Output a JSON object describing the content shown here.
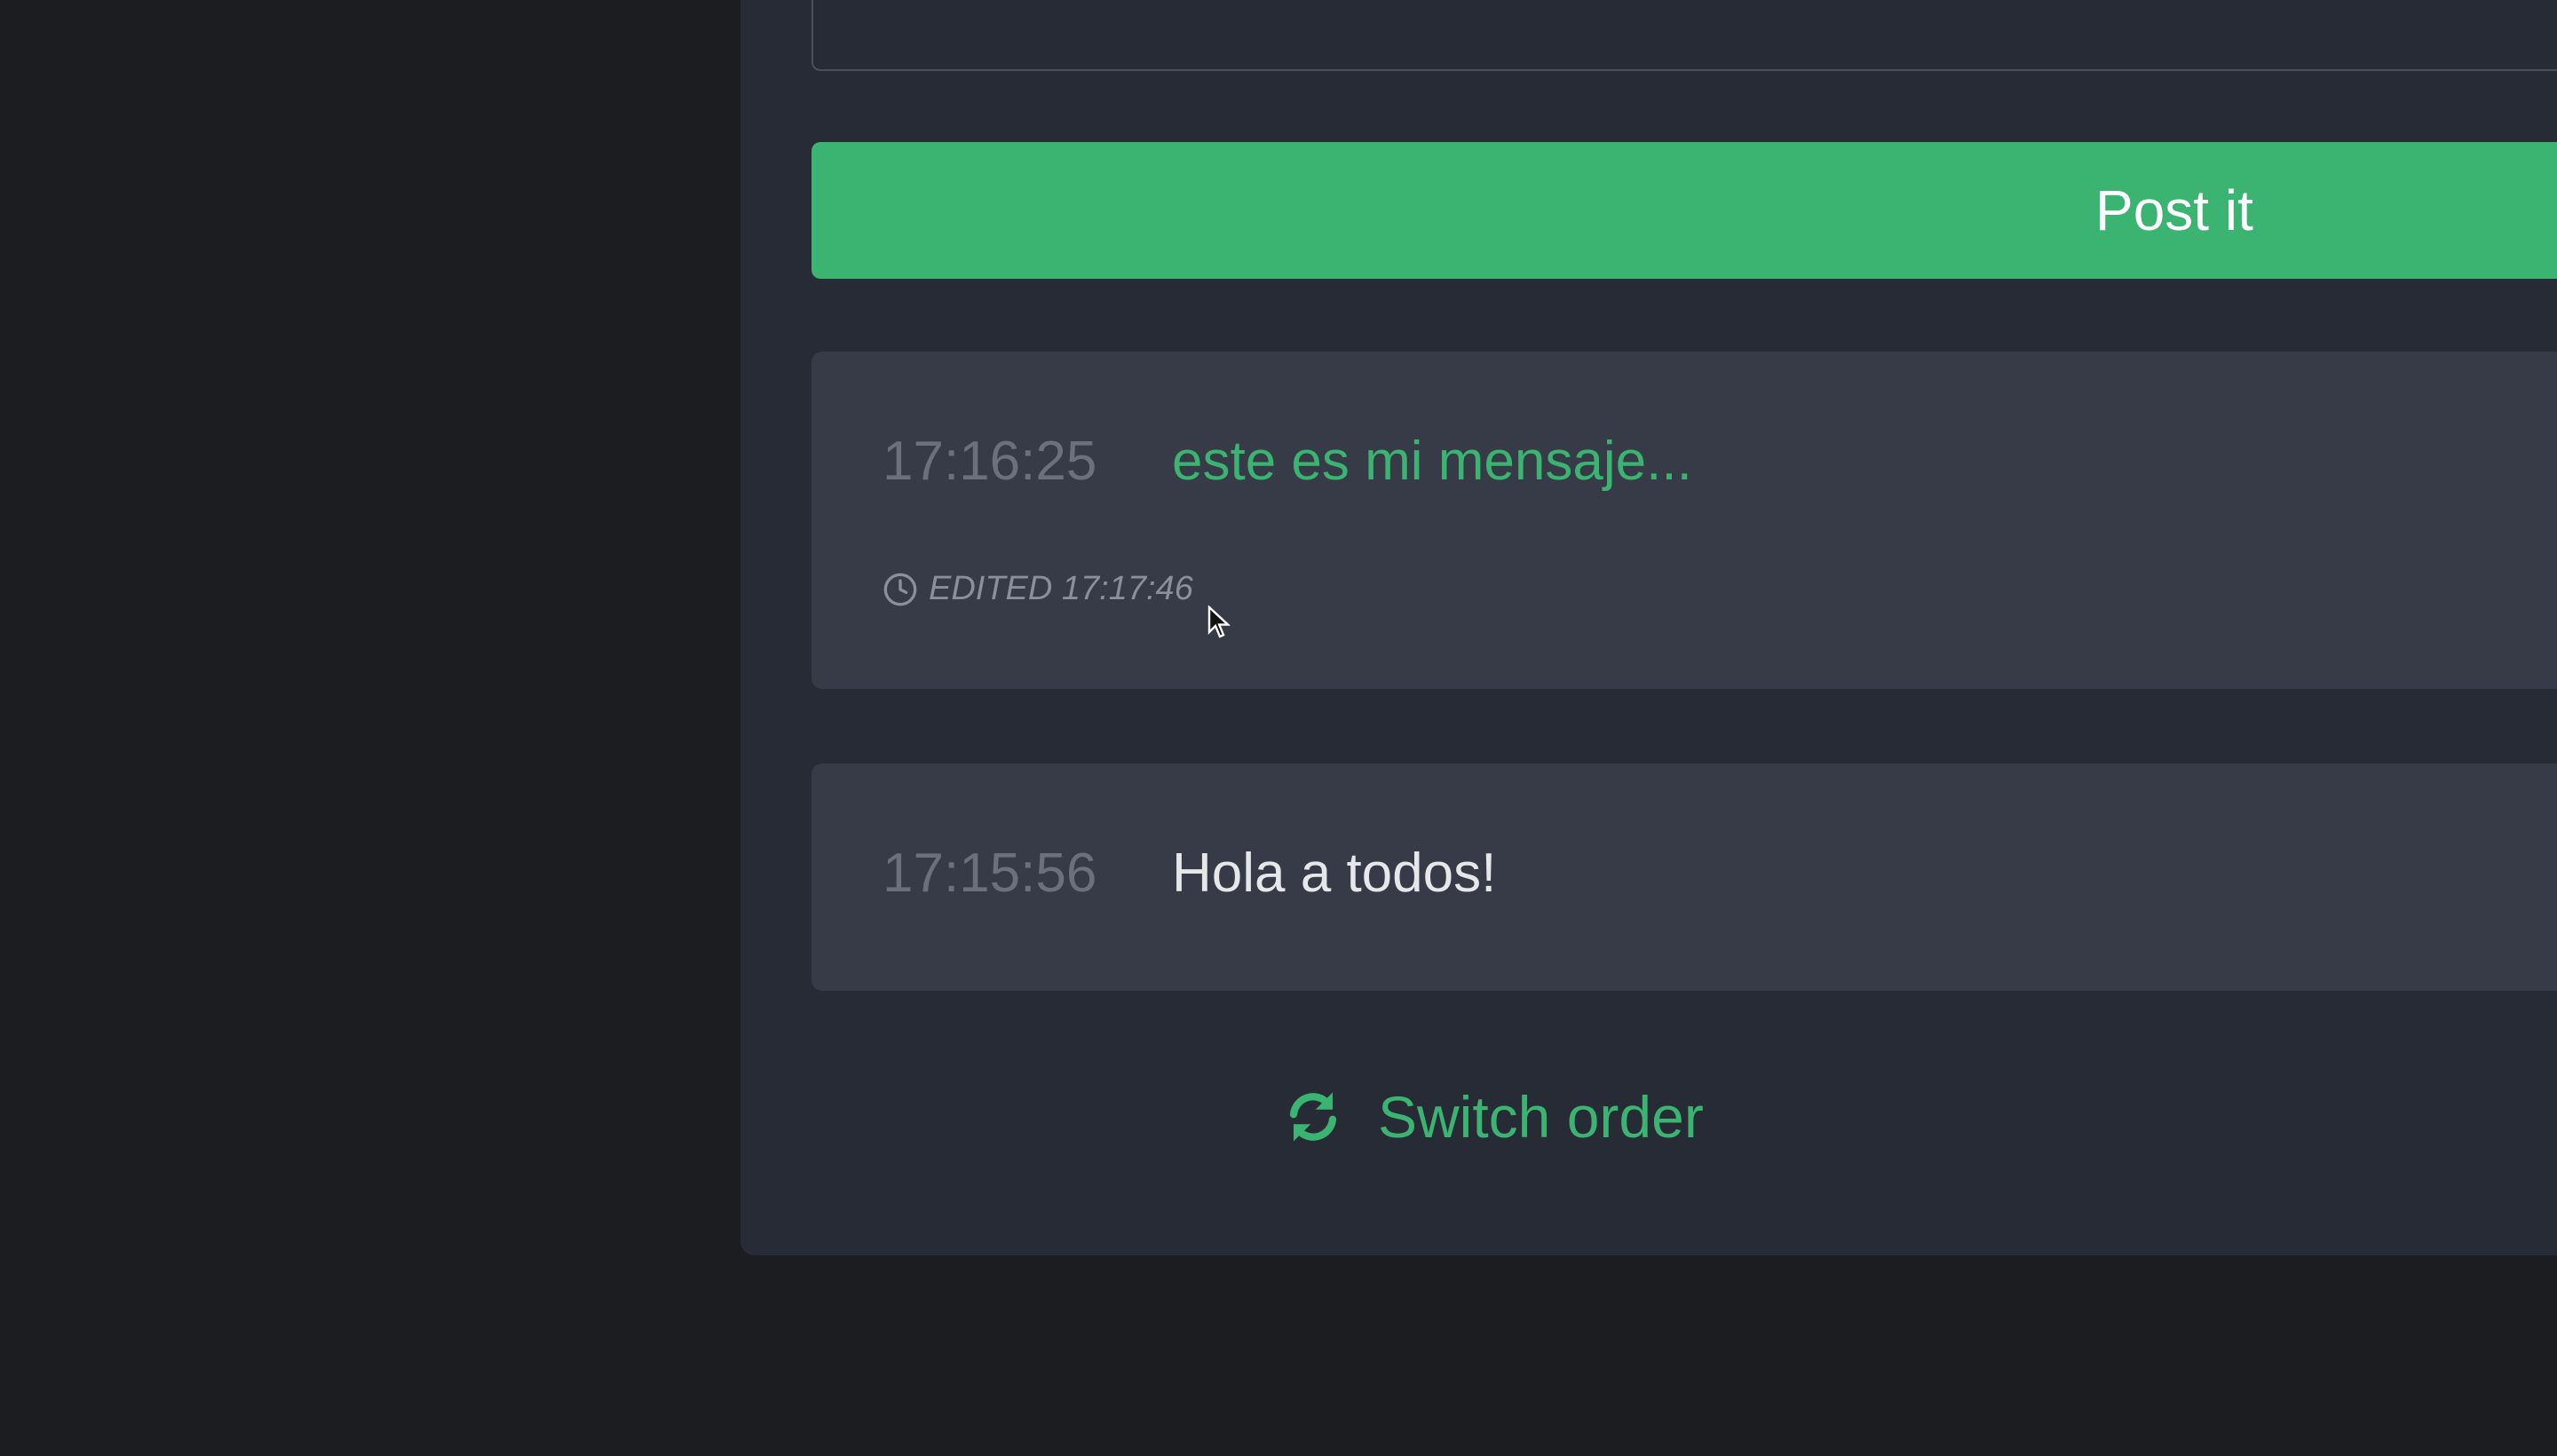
{
  "composer": {
    "post_button_label": "Post it"
  },
  "messages": [
    {
      "time": "17:16:25",
      "text": "este es mi mensaje...",
      "edited_label": "EDITED 17:17:46"
    },
    {
      "time": "17:15:56",
      "text": "Hola a todos!"
    }
  ],
  "footer": {
    "switch_order_label": "Switch order"
  },
  "icons": {
    "edited": "clock-icon",
    "switch_order": "refresh-icon"
  },
  "colors": {
    "accent": "#3bb371",
    "panel": "#272b35",
    "card": "#363b47",
    "background": "#1b1d21"
  }
}
